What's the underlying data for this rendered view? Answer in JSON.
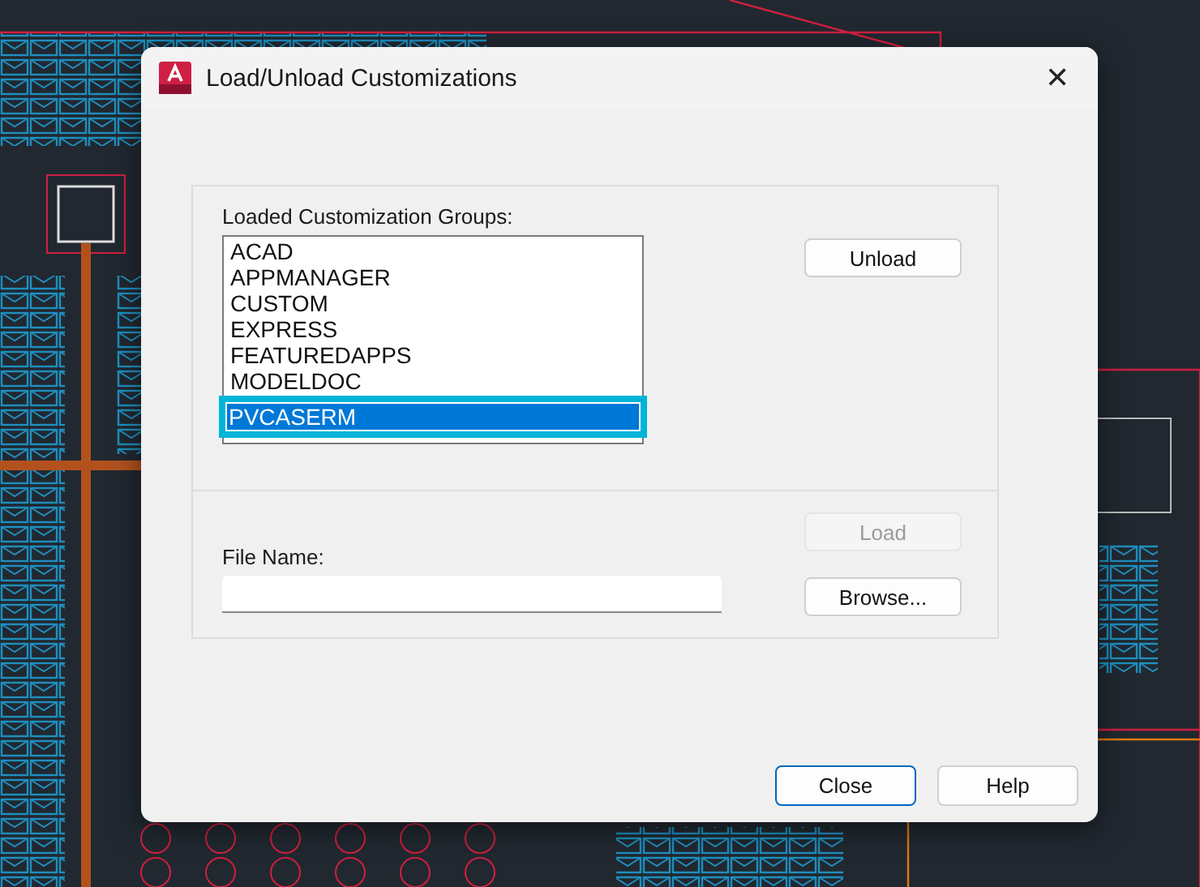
{
  "dialog": {
    "title": "Load/Unload Customizations",
    "close_glyph": "✕"
  },
  "groups": {
    "label": "Loaded Customization Groups:",
    "items": [
      {
        "text": "ACAD",
        "selected": false
      },
      {
        "text": "APPMANAGER",
        "selected": false
      },
      {
        "text": "CUSTOM",
        "selected": false
      },
      {
        "text": "EXPRESS",
        "selected": false
      },
      {
        "text": "FEATUREDAPPS",
        "selected": false
      },
      {
        "text": "MODELDOC",
        "selected": false
      },
      {
        "text": "PVCASERM",
        "selected": true
      }
    ]
  },
  "unload_button": {
    "label": "Unload",
    "disabled": false
  },
  "file": {
    "label": "File Name:"
  },
  "load_button": {
    "label": "Load",
    "disabled": true
  },
  "browse_button": {
    "label": "Browse...",
    "disabled": false
  },
  "footer_buttons": [
    {
      "label": "Close",
      "default": true
    },
    {
      "label": "Help",
      "default": false
    }
  ]
}
